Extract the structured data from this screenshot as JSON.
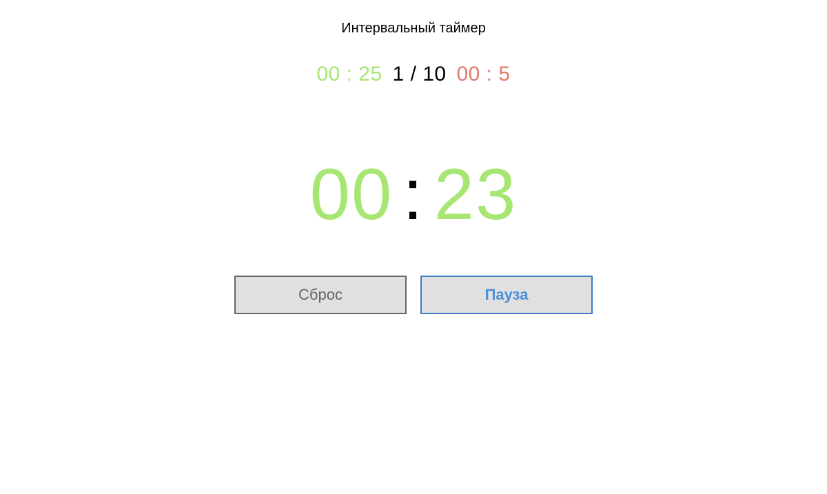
{
  "title": "Интервальный таймер",
  "config": {
    "work_minutes": "00",
    "work_seconds": "25",
    "current_round": "1",
    "total_rounds": "10",
    "rest_minutes": "00",
    "rest_seconds": "5",
    "colon": " : ",
    "slash": " / "
  },
  "timer": {
    "minutes": "00",
    "seconds": "23",
    "colon": ":"
  },
  "buttons": {
    "reset_label": "Сброс",
    "pause_label": "Пауза"
  },
  "colors": {
    "work": "#a8e673",
    "rest": "#e07a6a",
    "primary": "#4a8fd8",
    "button_bg": "#e0e0e0"
  }
}
